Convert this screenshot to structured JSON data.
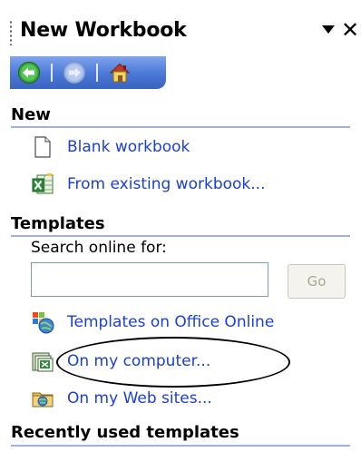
{
  "pane": {
    "title": "New Workbook"
  },
  "sections": {
    "new": {
      "heading": "New",
      "blank_workbook": "Blank workbook",
      "from_existing": "From existing workbook..."
    },
    "templates": {
      "heading": "Templates",
      "search_label": "Search online for:",
      "search_value": "",
      "go_label": "Go",
      "office_online": "Templates on Office Online",
      "on_my_computer": "On my computer...",
      "on_my_web_sites": "On my Web sites..."
    },
    "recent": {
      "heading": "Recently used templates"
    }
  },
  "icons": {
    "grip": "grip-icon",
    "menu": "dropdown-arrow-icon",
    "close": "close-icon",
    "back": "back-arrow-icon",
    "forward": "forward-arrow-icon",
    "home": "home-icon",
    "blank": "blank-document-icon",
    "existing": "excel-workbook-icon",
    "office_online": "office-online-icon",
    "computer": "templates-folder-icon",
    "web_sites": "web-folder-icon"
  },
  "colors": {
    "link": "#1a3fd6",
    "toolbar": "#4a78d6",
    "rule": "#9db3df"
  }
}
